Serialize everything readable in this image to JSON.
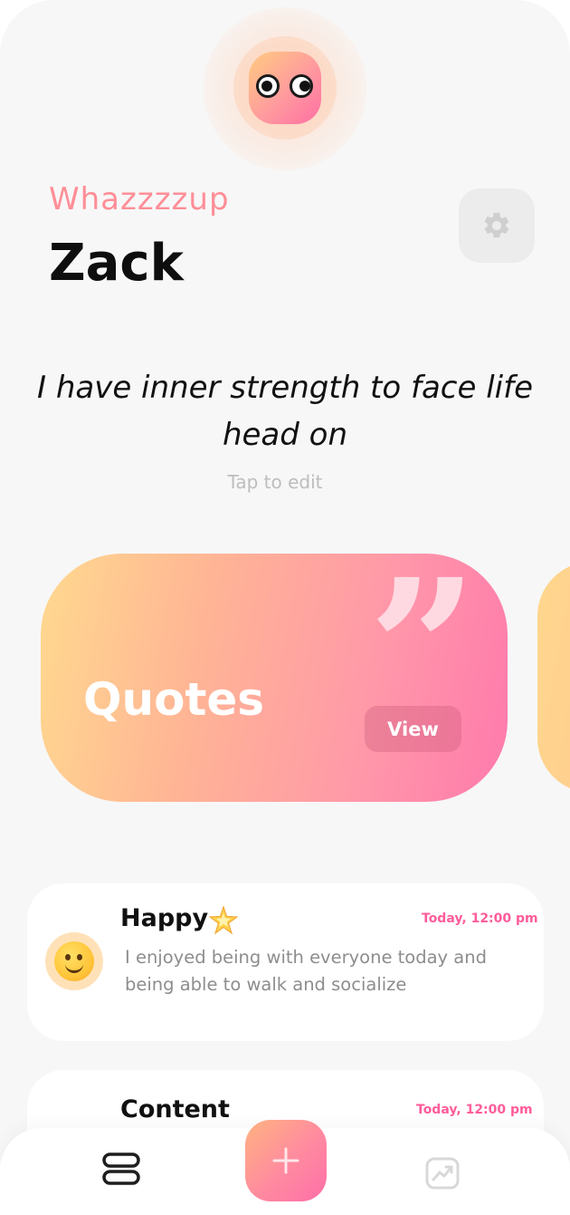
{
  "header": {
    "greeting": "Whazzzzup",
    "username": "Zack"
  },
  "affirmation": {
    "text": "I have inner strength to face life head on",
    "hint": "Tap to edit"
  },
  "quotes_card": {
    "title": "Quotes",
    "button_label": "View"
  },
  "entries": [
    {
      "mood": "Happy",
      "time": "Today, 12:00 pm",
      "text": "I enjoyed being with everyone today and being able to walk and socialize"
    },
    {
      "mood": "Content",
      "time": "Today, 12:00 pm"
    }
  ],
  "icons": {
    "settings": "gear-icon",
    "mood": "smiley-face-icon",
    "sparkle": "sparkle-star-icon",
    "nav_list": "list-icon",
    "nav_add": "plus-icon",
    "nav_stats": "chart-icon"
  },
  "colors": {
    "accent_pink": "#ff5c9a",
    "greeting": "#ff8e97",
    "background": "#f7f7f7"
  }
}
